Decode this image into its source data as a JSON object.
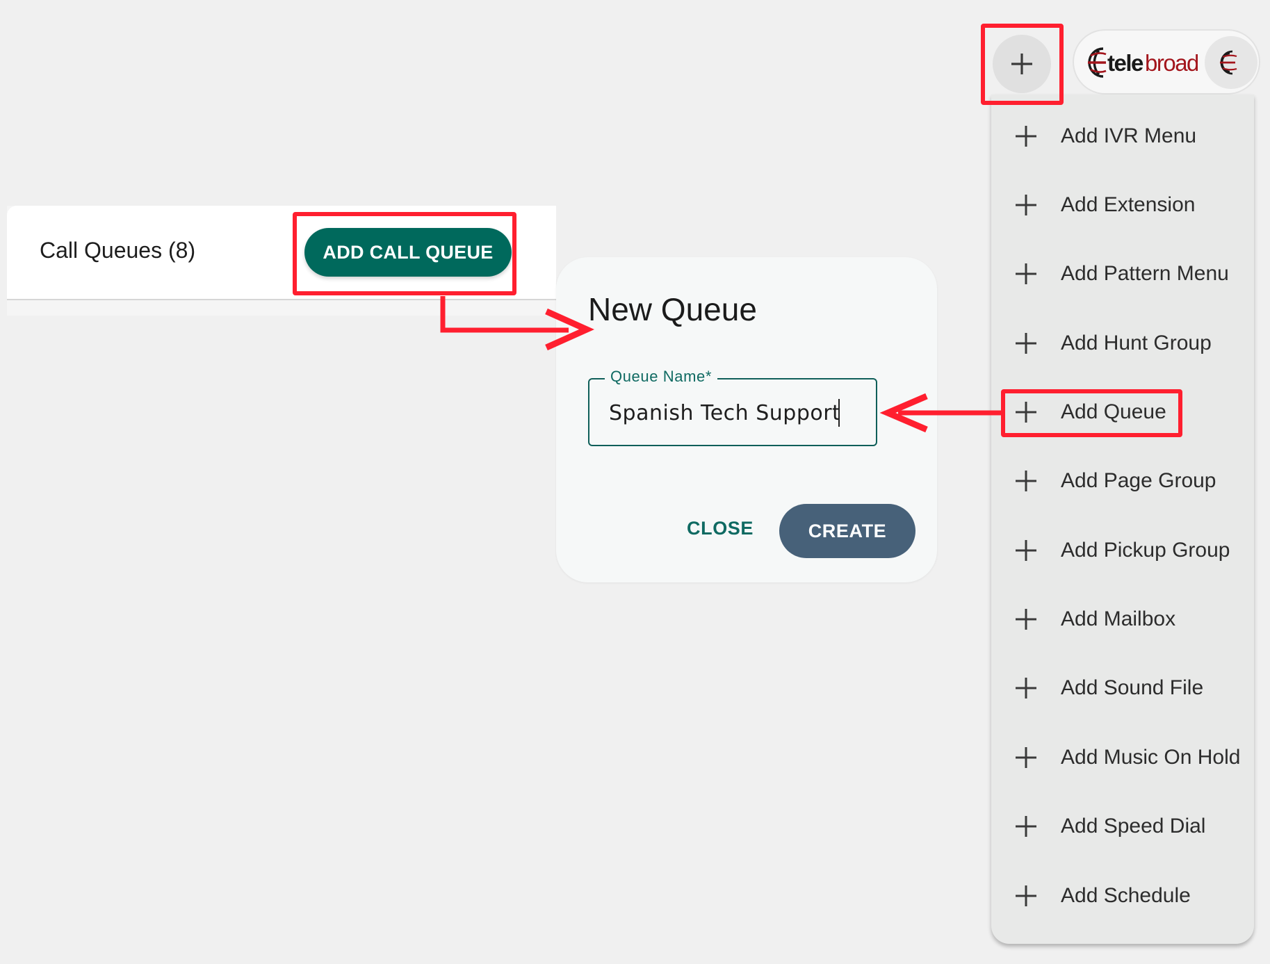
{
  "queues_header": {
    "title": "Call Queues (8)",
    "add_button_label": "ADD CALL QUEUE"
  },
  "dialog": {
    "title": "New Queue",
    "field_label": "Queue Name*",
    "field_value": "Spanish Tech Support",
    "close_label": "CLOSE",
    "create_label": "CREATE"
  },
  "topbar": {
    "plus_icon": "plus-icon",
    "brand_logo_text": "telebroad",
    "avatar_icon": "globe-logo-icon"
  },
  "add_menu": {
    "items": [
      {
        "label": "Add IVR Menu"
      },
      {
        "label": "Add Extension"
      },
      {
        "label": "Add Pattern Menu"
      },
      {
        "label": "Add Hunt Group"
      },
      {
        "label": "Add Queue"
      },
      {
        "label": "Add Page Group"
      },
      {
        "label": "Add Pickup Group"
      },
      {
        "label": "Add Mailbox"
      },
      {
        "label": "Add Sound File"
      },
      {
        "label": "Add Music On Hold"
      },
      {
        "label": "Add Speed Dial"
      },
      {
        "label": "Add Schedule"
      }
    ]
  },
  "colors": {
    "primary_teal": "#00695c",
    "create_button": "#476179",
    "annotation_red": "#ff1f2f",
    "brand_red": "#a3151c"
  }
}
